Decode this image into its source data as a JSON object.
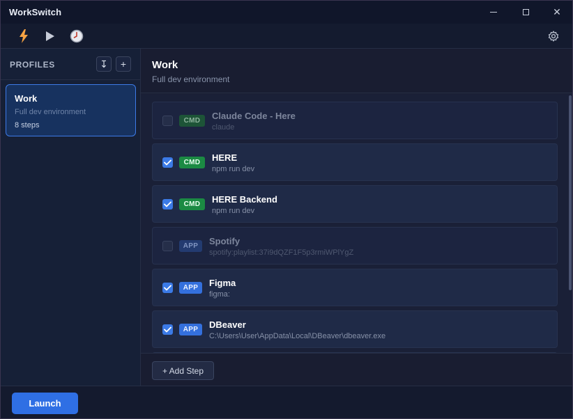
{
  "window": {
    "title": "WorkSwitch",
    "minimize_icon": "minimize-icon",
    "maximize_icon": "maximize-icon",
    "close_icon": "close-icon",
    "close_glyph": "✕"
  },
  "toolbar": {
    "items": [
      {
        "icon": "lightning-icon",
        "color": "#f5a243"
      },
      {
        "icon": "play-icon",
        "color": "#c7ccd8"
      },
      {
        "icon": "clock-icon",
        "color": "#d6d9e2"
      }
    ],
    "settings_icon": "gear-icon"
  },
  "sidebar": {
    "title": "PROFILES",
    "import_glyph": "↧",
    "add_glyph": "+",
    "profiles": [
      {
        "name": "Work",
        "description": "Full dev environment",
        "steps": "8 steps",
        "selected": true
      }
    ]
  },
  "main": {
    "title": "Work",
    "subtitle": "Full dev environment",
    "steps": [
      {
        "enabled": false,
        "type": "CMD",
        "name": "Claude Code - Here",
        "command": "claude"
      },
      {
        "enabled": true,
        "type": "CMD",
        "name": "HERE",
        "command": "npm run dev"
      },
      {
        "enabled": true,
        "type": "CMD",
        "name": "HERE Backend",
        "command": "npm run dev"
      },
      {
        "enabled": false,
        "type": "APP",
        "name": "Spotify",
        "command": "spotify:playlist:37i9dQZF1F5p3rmiWPlYgZ"
      },
      {
        "enabled": true,
        "type": "APP",
        "name": "Figma",
        "command": "figma:"
      },
      {
        "enabled": true,
        "type": "APP",
        "name": "DBeaver",
        "command": "C:\\Users\\User\\AppData\\Local\\DBeaver\\dbeaver.exe"
      }
    ],
    "add_step_label": "+ Add Step"
  },
  "footer": {
    "launch_label": "Launch"
  },
  "colors": {
    "accent": "#2f6fe4",
    "cmd_badge": "#1b8a43",
    "app_badge": "#3470dd"
  }
}
